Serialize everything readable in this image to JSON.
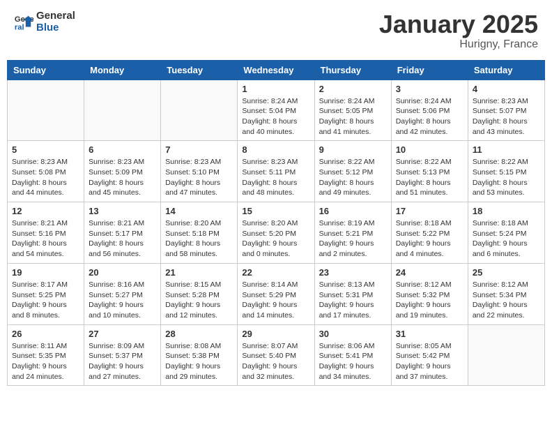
{
  "logo": {
    "line1": "General",
    "line2": "Blue"
  },
  "title": "January 2025",
  "location": "Hurigny, France",
  "days_of_week": [
    "Sunday",
    "Monday",
    "Tuesday",
    "Wednesday",
    "Thursday",
    "Friday",
    "Saturday"
  ],
  "weeks": [
    [
      {
        "day": "",
        "info": ""
      },
      {
        "day": "",
        "info": ""
      },
      {
        "day": "",
        "info": ""
      },
      {
        "day": "1",
        "info": "Sunrise: 8:24 AM\nSunset: 5:04 PM\nDaylight: 8 hours\nand 40 minutes."
      },
      {
        "day": "2",
        "info": "Sunrise: 8:24 AM\nSunset: 5:05 PM\nDaylight: 8 hours\nand 41 minutes."
      },
      {
        "day": "3",
        "info": "Sunrise: 8:24 AM\nSunset: 5:06 PM\nDaylight: 8 hours\nand 42 minutes."
      },
      {
        "day": "4",
        "info": "Sunrise: 8:23 AM\nSunset: 5:07 PM\nDaylight: 8 hours\nand 43 minutes."
      }
    ],
    [
      {
        "day": "5",
        "info": "Sunrise: 8:23 AM\nSunset: 5:08 PM\nDaylight: 8 hours\nand 44 minutes."
      },
      {
        "day": "6",
        "info": "Sunrise: 8:23 AM\nSunset: 5:09 PM\nDaylight: 8 hours\nand 45 minutes."
      },
      {
        "day": "7",
        "info": "Sunrise: 8:23 AM\nSunset: 5:10 PM\nDaylight: 8 hours\nand 47 minutes."
      },
      {
        "day": "8",
        "info": "Sunrise: 8:23 AM\nSunset: 5:11 PM\nDaylight: 8 hours\nand 48 minutes."
      },
      {
        "day": "9",
        "info": "Sunrise: 8:22 AM\nSunset: 5:12 PM\nDaylight: 8 hours\nand 49 minutes."
      },
      {
        "day": "10",
        "info": "Sunrise: 8:22 AM\nSunset: 5:13 PM\nDaylight: 8 hours\nand 51 minutes."
      },
      {
        "day": "11",
        "info": "Sunrise: 8:22 AM\nSunset: 5:15 PM\nDaylight: 8 hours\nand 53 minutes."
      }
    ],
    [
      {
        "day": "12",
        "info": "Sunrise: 8:21 AM\nSunset: 5:16 PM\nDaylight: 8 hours\nand 54 minutes."
      },
      {
        "day": "13",
        "info": "Sunrise: 8:21 AM\nSunset: 5:17 PM\nDaylight: 8 hours\nand 56 minutes."
      },
      {
        "day": "14",
        "info": "Sunrise: 8:20 AM\nSunset: 5:18 PM\nDaylight: 8 hours\nand 58 minutes."
      },
      {
        "day": "15",
        "info": "Sunrise: 8:20 AM\nSunset: 5:20 PM\nDaylight: 9 hours\nand 0 minutes."
      },
      {
        "day": "16",
        "info": "Sunrise: 8:19 AM\nSunset: 5:21 PM\nDaylight: 9 hours\nand 2 minutes."
      },
      {
        "day": "17",
        "info": "Sunrise: 8:18 AM\nSunset: 5:22 PM\nDaylight: 9 hours\nand 4 minutes."
      },
      {
        "day": "18",
        "info": "Sunrise: 8:18 AM\nSunset: 5:24 PM\nDaylight: 9 hours\nand 6 minutes."
      }
    ],
    [
      {
        "day": "19",
        "info": "Sunrise: 8:17 AM\nSunset: 5:25 PM\nDaylight: 9 hours\nand 8 minutes."
      },
      {
        "day": "20",
        "info": "Sunrise: 8:16 AM\nSunset: 5:27 PM\nDaylight: 9 hours\nand 10 minutes."
      },
      {
        "day": "21",
        "info": "Sunrise: 8:15 AM\nSunset: 5:28 PM\nDaylight: 9 hours\nand 12 minutes."
      },
      {
        "day": "22",
        "info": "Sunrise: 8:14 AM\nSunset: 5:29 PM\nDaylight: 9 hours\nand 14 minutes."
      },
      {
        "day": "23",
        "info": "Sunrise: 8:13 AM\nSunset: 5:31 PM\nDaylight: 9 hours\nand 17 minutes."
      },
      {
        "day": "24",
        "info": "Sunrise: 8:12 AM\nSunset: 5:32 PM\nDaylight: 9 hours\nand 19 minutes."
      },
      {
        "day": "25",
        "info": "Sunrise: 8:12 AM\nSunset: 5:34 PM\nDaylight: 9 hours\nand 22 minutes."
      }
    ],
    [
      {
        "day": "26",
        "info": "Sunrise: 8:11 AM\nSunset: 5:35 PM\nDaylight: 9 hours\nand 24 minutes."
      },
      {
        "day": "27",
        "info": "Sunrise: 8:09 AM\nSunset: 5:37 PM\nDaylight: 9 hours\nand 27 minutes."
      },
      {
        "day": "28",
        "info": "Sunrise: 8:08 AM\nSunset: 5:38 PM\nDaylight: 9 hours\nand 29 minutes."
      },
      {
        "day": "29",
        "info": "Sunrise: 8:07 AM\nSunset: 5:40 PM\nDaylight: 9 hours\nand 32 minutes."
      },
      {
        "day": "30",
        "info": "Sunrise: 8:06 AM\nSunset: 5:41 PM\nDaylight: 9 hours\nand 34 minutes."
      },
      {
        "day": "31",
        "info": "Sunrise: 8:05 AM\nSunset: 5:42 PM\nDaylight: 9 hours\nand 37 minutes."
      },
      {
        "day": "",
        "info": ""
      }
    ]
  ]
}
